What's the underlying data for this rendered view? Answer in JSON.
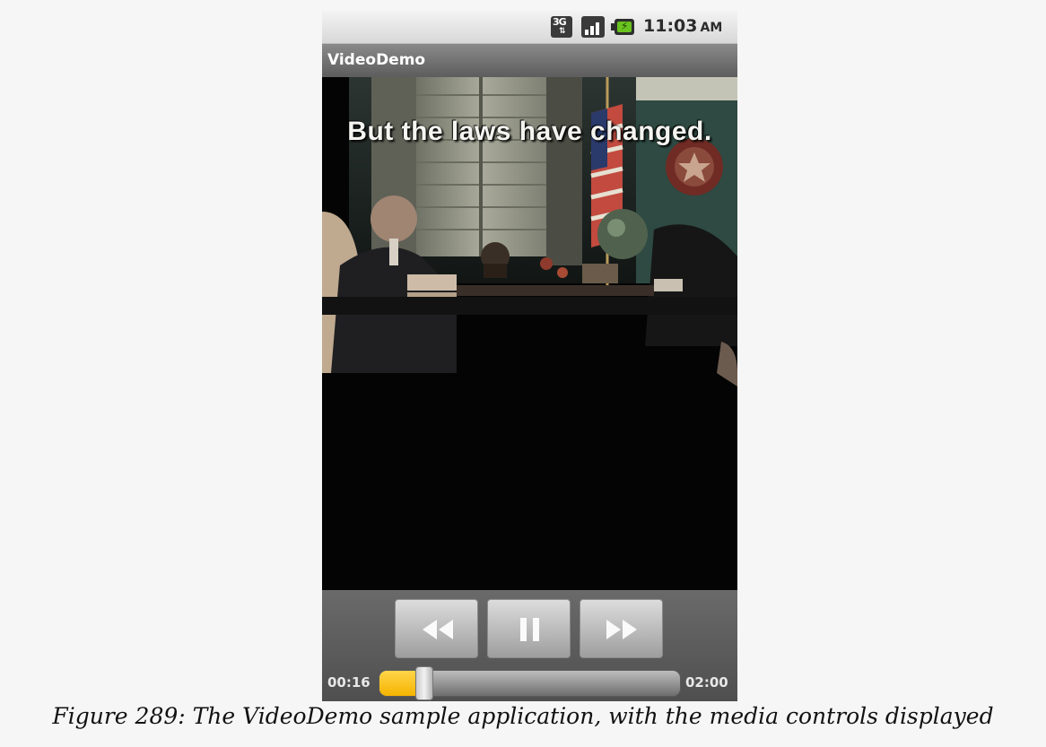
{
  "status_bar": {
    "network_label": "3G",
    "time": "11:03",
    "ampm": "AM",
    "icons": [
      "network-3g-icon",
      "signal-strength-icon",
      "battery-charging-icon"
    ],
    "battery_color": "#69c21f"
  },
  "app": {
    "title": "VideoDemo"
  },
  "video": {
    "subtitle": "But the laws have changed."
  },
  "controls": {
    "buttons": [
      "rewind-icon",
      "pause-icon",
      "fast-forward-icon"
    ],
    "current_time": "00:16",
    "total_time": "02:00",
    "progress": 0.133,
    "progress_color": "#f5b400"
  },
  "caption": "Figure 289: The VideoDemo sample application, with the media controls displayed"
}
